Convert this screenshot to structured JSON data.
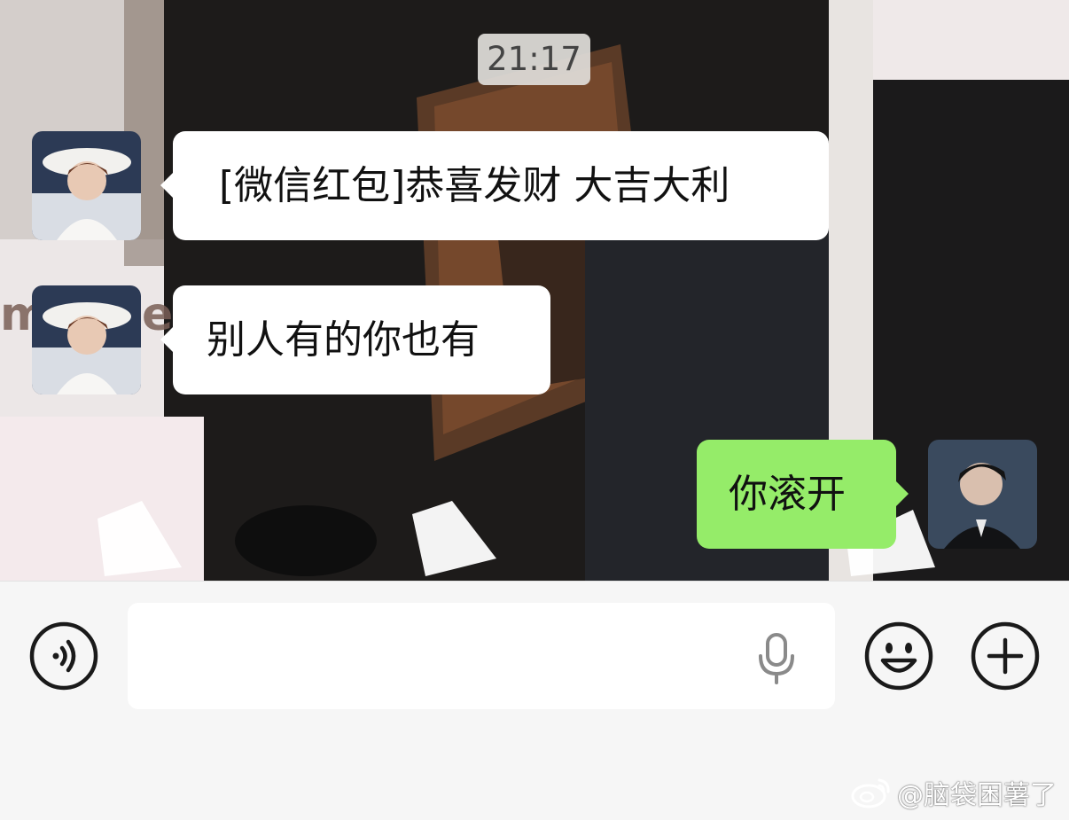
{
  "chat": {
    "timestamp": "21:17",
    "messages": [
      {
        "direction": "incoming",
        "text": "[微信红包]恭喜发财 大吉大利",
        "avatar": "contact-avatar"
      },
      {
        "direction": "incoming",
        "text": "别人有的你也有",
        "avatar": "contact-avatar"
      },
      {
        "direction": "outgoing",
        "text": "你滚开",
        "avatar": "self-avatar"
      }
    ]
  },
  "input_bar": {
    "voice_icon": "voice-mode-icon",
    "mic_icon": "microphone-icon",
    "emoji_icon": "emoji-icon",
    "plus_icon": "plus-icon",
    "input_value": ""
  },
  "colors": {
    "outgoing_bubble": "#95ec69",
    "incoming_bubble": "#ffffff",
    "input_bar_bg": "#f6f6f6"
  },
  "watermark": {
    "text": "@脑袋困薯了",
    "icon": "weibo-logo"
  }
}
